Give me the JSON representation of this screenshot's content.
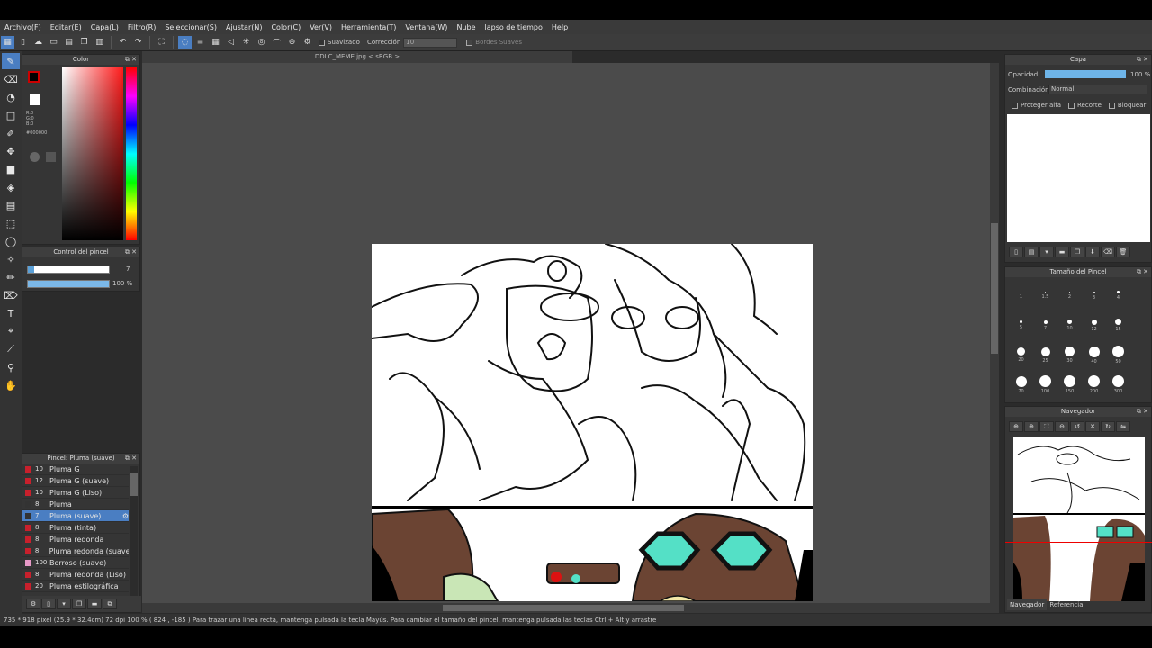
{
  "menu": [
    "Archivo(F)",
    "Editar(E)",
    "Capa(L)",
    "Filtro(R)",
    "Seleccionar(S)",
    "Ajustar(N)",
    "Color(C)",
    "Ver(V)",
    "Herramienta(T)",
    "Ventana(W)",
    "Nube",
    "lapso de tiempo",
    "Help"
  ],
  "toolbar": {
    "suavizado": "Suavizado",
    "correccion_label": "Corrección",
    "correccion_value": "10",
    "bordes": "Bordes Suaves"
  },
  "document_tab": "DDLC_MEME.jpg < sRGB >",
  "color_panel": {
    "title": "Color",
    "r": "R:0",
    "g": "G:0",
    "b": "B:0",
    "hex": "#000000"
  },
  "brush_control": {
    "title": "Control del pincel",
    "size": "7",
    "opacity": "100 %"
  },
  "brush_panel": {
    "title": "Pincel: Pluma (suave)",
    "items": [
      {
        "size": "10",
        "name": "Pluma G"
      },
      {
        "size": "12",
        "name": "Pluma G (suave)"
      },
      {
        "size": "10",
        "name": "Pluma G (Liso)"
      },
      {
        "size": "8",
        "name": "Pluma"
      },
      {
        "size": "7",
        "name": "Pluma (suave)"
      },
      {
        "size": "8",
        "name": "Pluma (tinta)"
      },
      {
        "size": "8",
        "name": "Pluma redonda"
      },
      {
        "size": "8",
        "name": "Pluma redonda (suave"
      },
      {
        "size": "100",
        "name": "Borroso (suave)"
      },
      {
        "size": "8",
        "name": "Pluma redonda (Liso)"
      },
      {
        "size": "20",
        "name": "Pluma estilográfica"
      }
    ]
  },
  "layer_panel": {
    "title": "Capa",
    "opacity_label": "Opacidad",
    "opacity_value": "100 %",
    "blend_label": "Combinación",
    "blend_value": "Normal",
    "protect_alpha": "Proteger alfa",
    "clipping": "Recorte",
    "lock": "Bloquear"
  },
  "brush_size_panel": {
    "title": "Tamaño del Pincel",
    "sizes": [
      "1",
      "1.5",
      "2",
      "3",
      "4",
      "5",
      "7",
      "10",
      "12",
      "15",
      "20",
      "25",
      "30",
      "40",
      "50",
      "70",
      "100",
      "150",
      "200",
      "300"
    ]
  },
  "navigator_panel": {
    "title": "Navegador",
    "tabs": [
      "Navegador",
      "Referencia"
    ]
  },
  "status": "735 * 918 pixel   (25.9 * 32.4cm)   72 dpi   100 %   ( 824 , -185 )   Para trazar una línea recta, mantenga pulsada la tecla Mayús. Para cambiar el tamaño del pincel, mantenga pulsada las teclas Ctrl + Alt y arrastre",
  "colors": {
    "accent": "#4a7ec2",
    "brush_swatch": "#c8202c",
    "panel_bg": "#353535",
    "canvas_bg": "#4b4b4b"
  }
}
